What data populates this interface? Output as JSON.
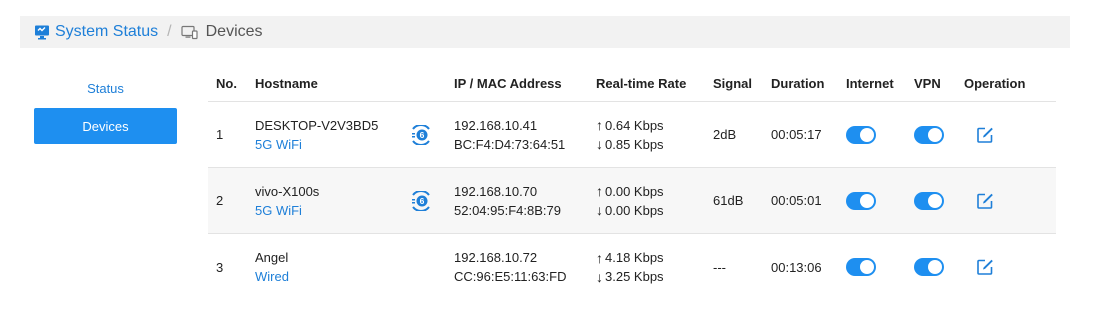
{
  "breadcrumb": {
    "root_label": "System Status",
    "separator": "/",
    "current_label": "Devices"
  },
  "sidebar": {
    "items": [
      {
        "label": "Status",
        "active": false
      },
      {
        "label": "Devices",
        "active": true
      }
    ]
  },
  "table": {
    "headers": {
      "no": "No.",
      "hostname": "Hostname",
      "ip_mac": "IP / MAC Address",
      "rate": "Real-time Rate",
      "signal": "Signal",
      "duration": "Duration",
      "internet": "Internet",
      "vpn": "VPN",
      "operation": "Operation"
    },
    "rows": [
      {
        "no": "1",
        "hostname": "DESKTOP-V2V3BD5",
        "connection": "5G WiFi",
        "wifi_icon": "wifi-6-icon",
        "ip": "192.168.10.41",
        "mac": "BC:F4:D4:73:64:51",
        "up": "0.64 Kbps",
        "down": "0.85 Kbps",
        "signal": "2dB",
        "duration": "00:05:17",
        "internet": true,
        "vpn": true
      },
      {
        "no": "2",
        "hostname": "vivo-X100s",
        "connection": "5G WiFi",
        "wifi_icon": "wifi-6-icon",
        "ip": "192.168.10.70",
        "mac": "52:04:95:F4:8B:79",
        "up": "0.00 Kbps",
        "down": "0.00 Kbps",
        "signal": "61dB",
        "duration": "00:05:01",
        "internet": true,
        "vpn": true
      },
      {
        "no": "3",
        "hostname": "Angel",
        "connection": "Wired",
        "ip": "192.168.10.72",
        "mac": "CC:96:E5:11:63:FD",
        "up": "4.18 Kbps",
        "down": "3.25 Kbps",
        "signal": "---",
        "duration": "00:13:06",
        "internet": true,
        "vpn": true
      }
    ]
  },
  "icons": {
    "arrow_up": "↑",
    "arrow_down": "↓"
  },
  "colors": {
    "accent": "#1e7fd8",
    "toggle_on": "#1e8ff0",
    "breadcrumb_bg": "#f2f2f2",
    "alt_row_bg": "#f7f7f7"
  }
}
